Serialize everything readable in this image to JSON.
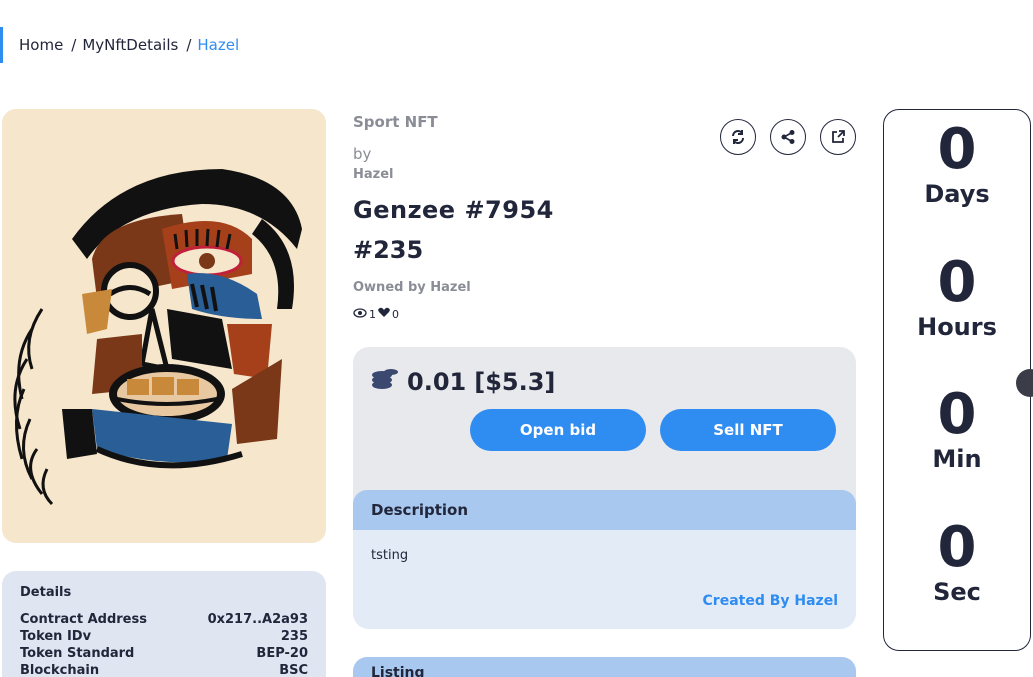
{
  "breadcrumb": {
    "home": "Home",
    "sep": "/",
    "page": "MyNftDetails",
    "current": "Hazel"
  },
  "nft": {
    "category": "Sport NFT",
    "by_label": "by",
    "creator": "Hazel",
    "name": "Genzee #7954",
    "token_number": "#235",
    "owned_by": "Owned by Hazel",
    "views": "1",
    "likes": "0"
  },
  "price": {
    "amount": "0.01",
    "usd": "[$5.3]"
  },
  "buttons": {
    "open_bid": "Open bid",
    "sell_nft": "Sell NFT"
  },
  "description": {
    "header": "Description",
    "text": "tsting",
    "created_by": "Created By Hazel"
  },
  "listing": {
    "header": "Listing"
  },
  "details": {
    "title": "Details",
    "rows": [
      {
        "label": "Contract Address",
        "value": "0x217..A2a93"
      },
      {
        "label": "Token IDv",
        "value": "235"
      },
      {
        "label": "Token Standard",
        "value": "BEP-20"
      },
      {
        "label": "Blockchain",
        "value": "BSC"
      }
    ]
  },
  "countdown": [
    {
      "value": "0",
      "unit": "Days"
    },
    {
      "value": "0",
      "unit": "Hours"
    },
    {
      "value": "0",
      "unit": "Min"
    },
    {
      "value": "0",
      "unit": "Sec"
    }
  ],
  "icons": {
    "refresh": "refresh-icon",
    "share": "share-icon",
    "external": "external-link-icon",
    "coins": "coins-icon",
    "eye": "eye-icon",
    "heart": "heart-icon"
  },
  "colors": {
    "accent": "#2f8cf0",
    "artwork_bg": "#f6e6cc",
    "panel_bg": "#e8e9ec",
    "desc_head_bg": "#a9c8f0"
  }
}
